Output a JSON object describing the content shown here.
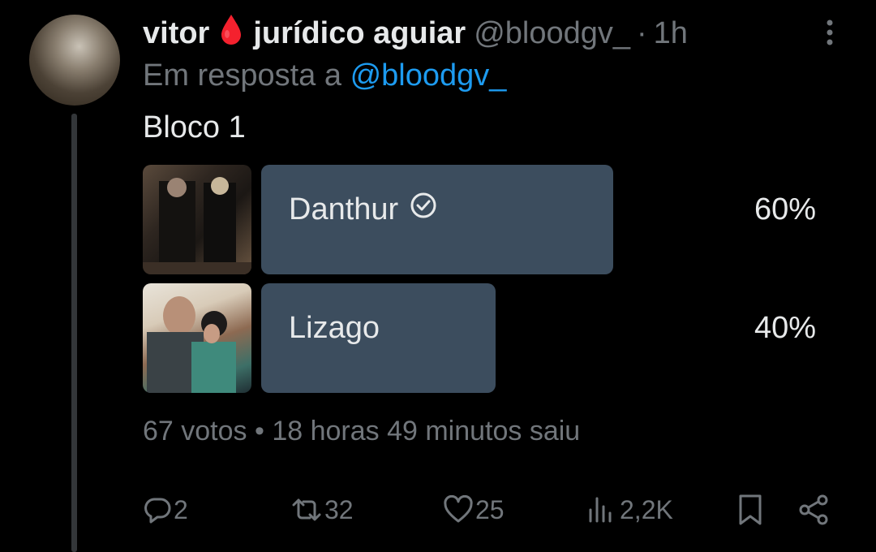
{
  "tweet": {
    "display_name_first": "vitor",
    "display_name_second": "jurídico aguiar",
    "handle": "@bloodgv_",
    "separator": "·",
    "time": "1h",
    "reply_prefix": "Em resposta a",
    "reply_mention": "@bloodgv_",
    "text": "Bloco 1"
  },
  "poll": {
    "options": [
      {
        "label": "Danthur",
        "percent": "60%",
        "fill_fraction": 0.6,
        "selected": true
      },
      {
        "label": "Lizago",
        "percent": "40%",
        "fill_fraction": 0.4,
        "selected": false
      }
    ],
    "meta": "67 votos • 18 horas 49 minutos saiu"
  },
  "actions": {
    "replies": "2",
    "reposts": "32",
    "likes": "25",
    "views": "2,2K"
  },
  "colors": {
    "background": "#000000",
    "text": "#e7e9ea",
    "muted": "#71767b",
    "link": "#1d9bf0",
    "poll_bar": "#3c4d5e",
    "drop": "#f4212e"
  },
  "icons": {
    "name_emoji": "blood-drop-icon",
    "selected": "check-circle-icon",
    "more": "more-vertical-icon",
    "reply": "reply-icon",
    "repost": "repost-icon",
    "like": "heart-icon",
    "views": "views-icon",
    "bookmark": "bookmark-icon",
    "share": "share-icon"
  }
}
